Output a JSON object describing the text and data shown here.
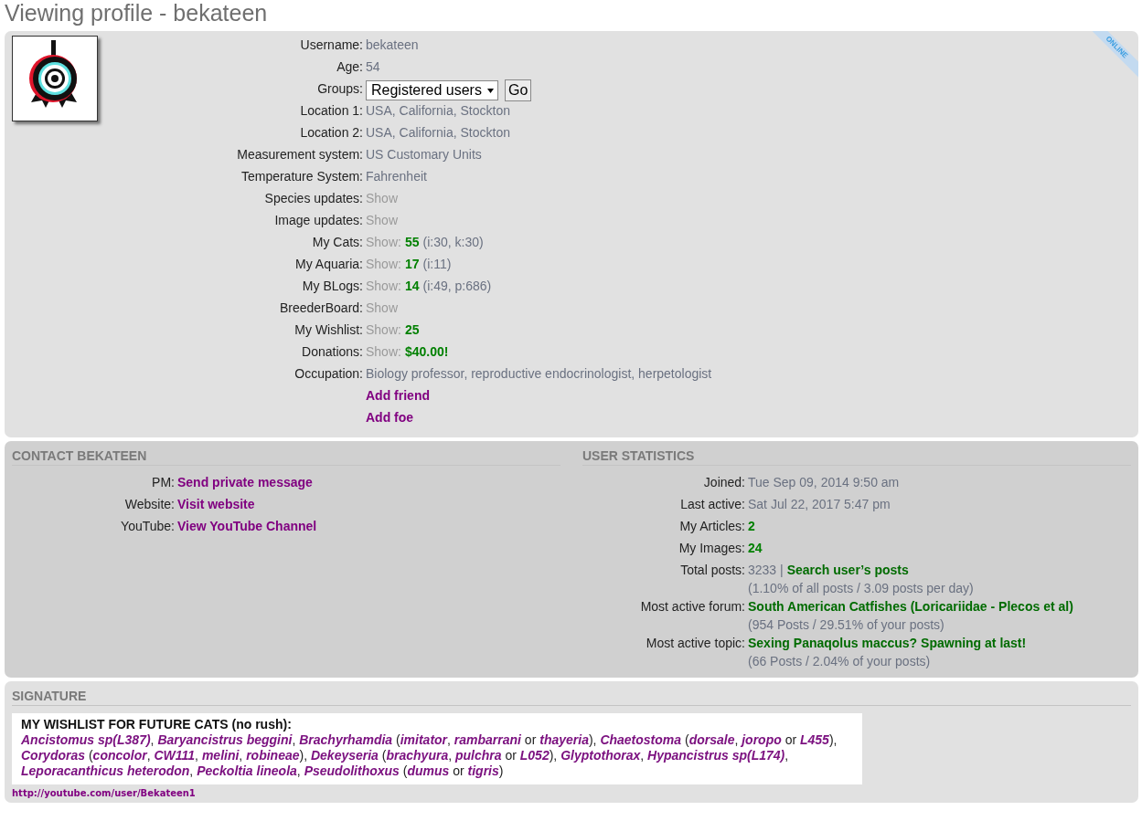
{
  "title": "Viewing profile - bekateen",
  "profile": {
    "status": "ONLINE",
    "rows": [
      {
        "label": "Username:",
        "parts": [
          {
            "kind": "text",
            "text": "bekateen"
          }
        ]
      },
      {
        "label": "Age:",
        "parts": [
          {
            "kind": "text",
            "text": "54"
          }
        ]
      },
      {
        "label": "Groups:",
        "kind": "select",
        "value": "Registered users",
        "button": "Go"
      },
      {
        "label": "Location 1:",
        "parts": [
          {
            "kind": "text",
            "text": "USA, California, Stockton"
          }
        ]
      },
      {
        "label": "Location 2:",
        "parts": [
          {
            "kind": "text",
            "text": "USA, California, Stockton"
          }
        ]
      },
      {
        "label": "Measurement system:",
        "parts": [
          {
            "kind": "text",
            "text": "US Customary Units"
          }
        ]
      },
      {
        "label": "Temperature System:",
        "parts": [
          {
            "kind": "text",
            "text": "Fahrenheit"
          }
        ]
      },
      {
        "label": "Species updates:",
        "parts": [
          {
            "kind": "muted",
            "text": "Show"
          }
        ]
      },
      {
        "label": "Image updates:",
        "parts": [
          {
            "kind": "muted",
            "text": "Show"
          }
        ]
      },
      {
        "label": "My Cats:",
        "parts": [
          {
            "kind": "muted",
            "text": "Show:"
          },
          {
            "kind": "count",
            "text": "55"
          },
          {
            "kind": "text",
            "text": "(i:30, k:30)"
          }
        ]
      },
      {
        "label": "My Aquaria:",
        "parts": [
          {
            "kind": "muted",
            "text": "Show:"
          },
          {
            "kind": "count",
            "text": "17"
          },
          {
            "kind": "text",
            "text": "(i:11)"
          }
        ]
      },
      {
        "label": "My BLogs:",
        "parts": [
          {
            "kind": "muted",
            "text": "Show:"
          },
          {
            "kind": "count",
            "text": "14"
          },
          {
            "kind": "text",
            "text": "(i:49, p:686)"
          }
        ]
      },
      {
        "label": "BreederBoard:",
        "parts": [
          {
            "kind": "muted",
            "text": "Show"
          }
        ]
      },
      {
        "label": "My Wishlist:",
        "parts": [
          {
            "kind": "muted",
            "text": "Show:"
          },
          {
            "kind": "count",
            "text": "25"
          }
        ]
      },
      {
        "label": "Donations:",
        "parts": [
          {
            "kind": "muted",
            "text": "Show:"
          },
          {
            "kind": "count",
            "text": "$40.00!"
          }
        ]
      },
      {
        "label": "Occupation:",
        "parts": [
          {
            "kind": "text",
            "text": "Biology professor, reproductive endocrinologist, herpetologist"
          }
        ]
      },
      {
        "parts": [
          {
            "kind": "link",
            "text": "Add friend"
          }
        ]
      },
      {
        "parts": [
          {
            "kind": "link",
            "text": "Add foe"
          }
        ]
      }
    ]
  },
  "contact": {
    "heading": "CONTACT BEKATEEN",
    "rows": [
      {
        "label": "PM:",
        "parts": [
          {
            "kind": "link",
            "text": "Send private message"
          }
        ]
      },
      {
        "label": "Website:",
        "parts": [
          {
            "kind": "link",
            "text": "Visit website"
          }
        ]
      },
      {
        "label": "YouTube:",
        "parts": [
          {
            "kind": "link",
            "text": "View YouTube Channel"
          }
        ]
      }
    ]
  },
  "statistics": {
    "heading": "USER STATISTICS",
    "rows": [
      {
        "label": "Joined:",
        "parts": [
          {
            "kind": "text",
            "text": "Tue Sep 09, 2014 9:50 am"
          }
        ]
      },
      {
        "label": "Last active:",
        "parts": [
          {
            "kind": "text",
            "text": "Sat Jul 22, 2017 5:47 pm"
          }
        ]
      },
      {
        "label": "My Articles:",
        "parts": [
          {
            "kind": "count",
            "text": "2"
          }
        ]
      },
      {
        "label": "My Images:",
        "parts": [
          {
            "kind": "count",
            "text": "24"
          }
        ]
      },
      {
        "label": "Total posts:",
        "parts": [
          {
            "kind": "text",
            "text": "3233 |"
          },
          {
            "kind": "green-link",
            "text": "Search user’s posts"
          }
        ],
        "note": "(1.10% of all posts / 3.09 posts per day)"
      },
      {
        "label": "Most active forum:",
        "parts": [
          {
            "kind": "green-link",
            "text": "South American Catfishes (Loricariidae - Plecos et al)"
          }
        ],
        "note": "(954 Posts / 29.51% of your posts)"
      },
      {
        "label": "Most active topic:",
        "parts": [
          {
            "kind": "green-link",
            "text": "Sexing Panaqolus maccus? Spawning at last!"
          }
        ],
        "note": "(66 Posts / 2.04% of your posts)"
      }
    ]
  },
  "signature": {
    "heading": "SIGNATURE",
    "title": "MY WISHLIST FOR FUTURE CATS (no rush):",
    "segments": [
      {
        "kind": "name",
        "text": "Ancistomus sp(L387)"
      },
      {
        "kind": "plain",
        "text": ", "
      },
      {
        "kind": "name",
        "text": "Baryancistrus beggini"
      },
      {
        "kind": "plain",
        "text": ", "
      },
      {
        "kind": "name",
        "text": "Brachyrhamdia"
      },
      {
        "kind": "plain",
        "text": " ("
      },
      {
        "kind": "name",
        "text": "imitator"
      },
      {
        "kind": "plain",
        "text": ", "
      },
      {
        "kind": "name",
        "text": "rambarrani"
      },
      {
        "kind": "plain",
        "text": " or "
      },
      {
        "kind": "name",
        "text": "thayeria"
      },
      {
        "kind": "plain",
        "text": "), "
      },
      {
        "kind": "name",
        "text": "Chaetostoma"
      },
      {
        "kind": "plain",
        "text": " ("
      },
      {
        "kind": "name",
        "text": "dorsale"
      },
      {
        "kind": "plain",
        "text": ", "
      },
      {
        "kind": "name",
        "text": "joropo"
      },
      {
        "kind": "plain",
        "text": " or "
      },
      {
        "kind": "name",
        "text": "L455"
      },
      {
        "kind": "plain",
        "text": "), "
      },
      {
        "kind": "name",
        "text": "Corydoras"
      },
      {
        "kind": "plain",
        "text": " ("
      },
      {
        "kind": "name",
        "text": "concolor"
      },
      {
        "kind": "plain",
        "text": ", "
      },
      {
        "kind": "name",
        "text": "CW111"
      },
      {
        "kind": "plain",
        "text": ", "
      },
      {
        "kind": "name",
        "text": "melini"
      },
      {
        "kind": "plain",
        "text": ", "
      },
      {
        "kind": "name",
        "text": "robineae"
      },
      {
        "kind": "plain",
        "text": "), "
      },
      {
        "kind": "name",
        "text": "Dekeyseria"
      },
      {
        "kind": "plain",
        "text": " ("
      },
      {
        "kind": "name",
        "text": "brachyura"
      },
      {
        "kind": "plain",
        "text": ", "
      },
      {
        "kind": "name",
        "text": "pulchra"
      },
      {
        "kind": "plain",
        "text": " or "
      },
      {
        "kind": "name",
        "text": "L052"
      },
      {
        "kind": "plain",
        "text": "), "
      },
      {
        "kind": "name",
        "text": "Glyptothorax"
      },
      {
        "kind": "plain",
        "text": ", "
      },
      {
        "kind": "name",
        "text": "Hypancistrus sp(L174)"
      },
      {
        "kind": "plain",
        "text": ", "
      },
      {
        "kind": "name",
        "text": "Leporacanthicus heterodon"
      },
      {
        "kind": "plain",
        "text": ", "
      },
      {
        "kind": "name",
        "text": "Peckoltia lineola"
      },
      {
        "kind": "plain",
        "text": ", "
      },
      {
        "kind": "name",
        "text": "Pseudolithoxus"
      },
      {
        "kind": "plain",
        "text": " ("
      },
      {
        "kind": "name",
        "text": "dumus"
      },
      {
        "kind": "plain",
        "text": " or "
      },
      {
        "kind": "name",
        "text": "tigris"
      },
      {
        "kind": "plain",
        "text": ")"
      }
    ],
    "link": "http://youtube.com/user/Bekateen1"
  }
}
